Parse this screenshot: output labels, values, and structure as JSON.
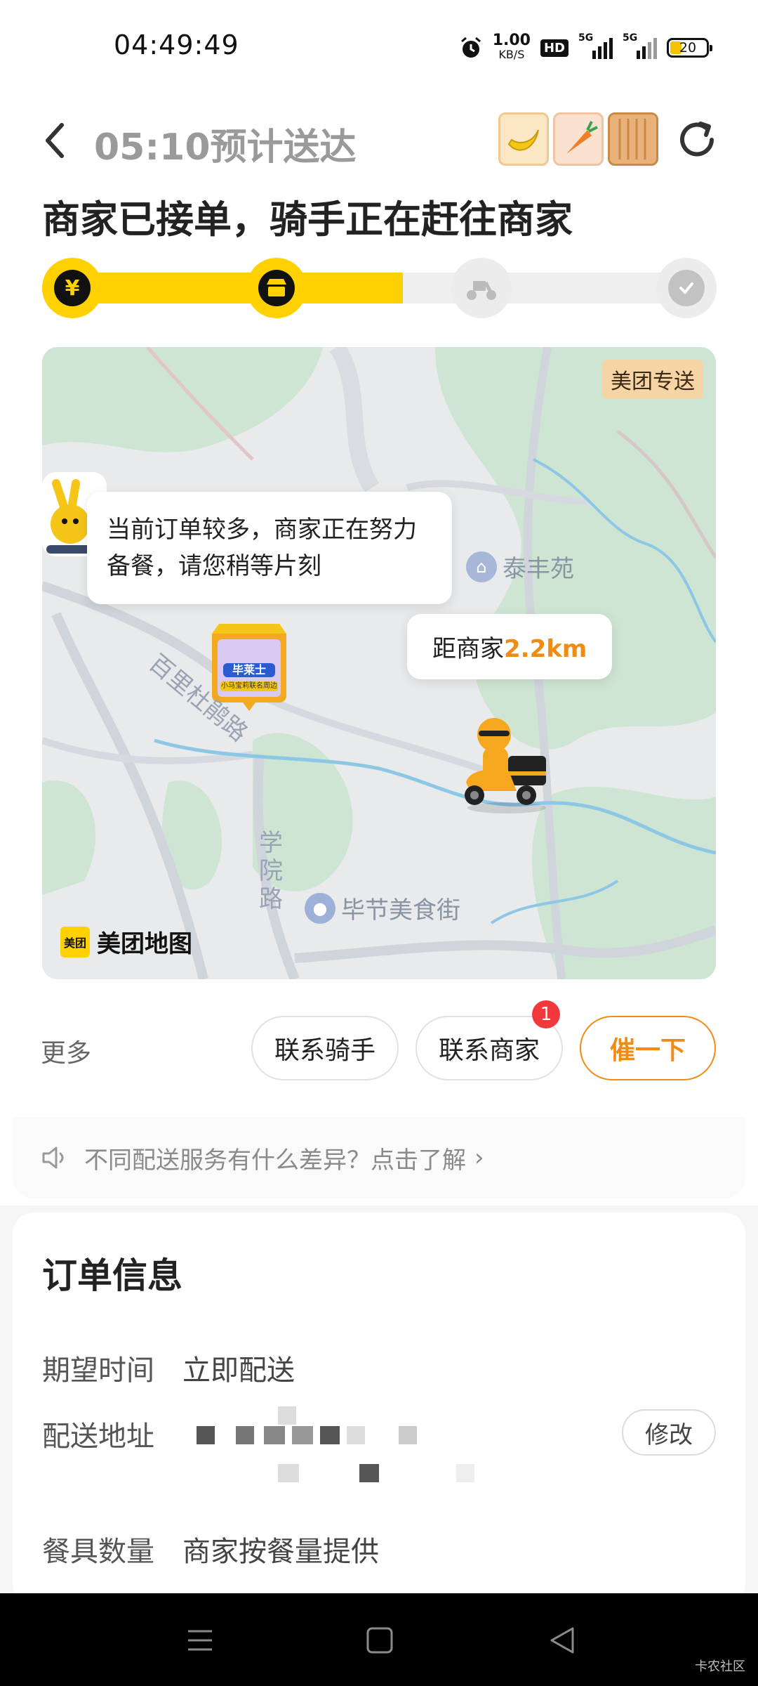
{
  "status_bar": {
    "time": "04:49:49",
    "net_speed_value": "1.00",
    "net_speed_unit": "KB/S",
    "hd": "HD",
    "signal1_label": "5G",
    "signal2_label": "5G",
    "battery": "20"
  },
  "header": {
    "eta": "05:10预计送达",
    "order_status": "商家已接单，骑手正在赶往商家"
  },
  "progress": {
    "fraction": 0.53,
    "steps": [
      "pay-yen-icon",
      "store-icon",
      "scooter-icon",
      "check-icon"
    ],
    "active_color": "#ffd100",
    "yen_glyph": "¥"
  },
  "map": {
    "badge": "美团专送",
    "notice": "当前订单较多，商家正在努力备餐，请您稍等片刻",
    "distance_prefix": "距商家",
    "distance_value": "2.2km",
    "place_taifengyuan": "泰丰苑",
    "place_food_street": "毕节美食街",
    "road_bailidujuan": "百里杜鹃路",
    "road_xueyuan": "学院路",
    "store_sign_name": "毕莱士",
    "store_sign_sub": "小马宝莉联名周边",
    "logo_box": "美团",
    "logo_text": "美团地图"
  },
  "actions": {
    "more": "更多",
    "contact_rider": "联系骑手",
    "contact_merchant": "联系商家",
    "merchant_badge": "1",
    "urge": "催一下"
  },
  "tip": {
    "text": "不同配送服务有什么差异？点击了解"
  },
  "order_info": {
    "title": "订单信息",
    "expected_time_label": "期望时间",
    "expected_time_value": "立即配送",
    "address_label": "配送地址",
    "edit": "修改",
    "utensils_label": "餐具数量",
    "utensils_value": "商家按餐量提供"
  },
  "watermark": "卡农社区"
}
